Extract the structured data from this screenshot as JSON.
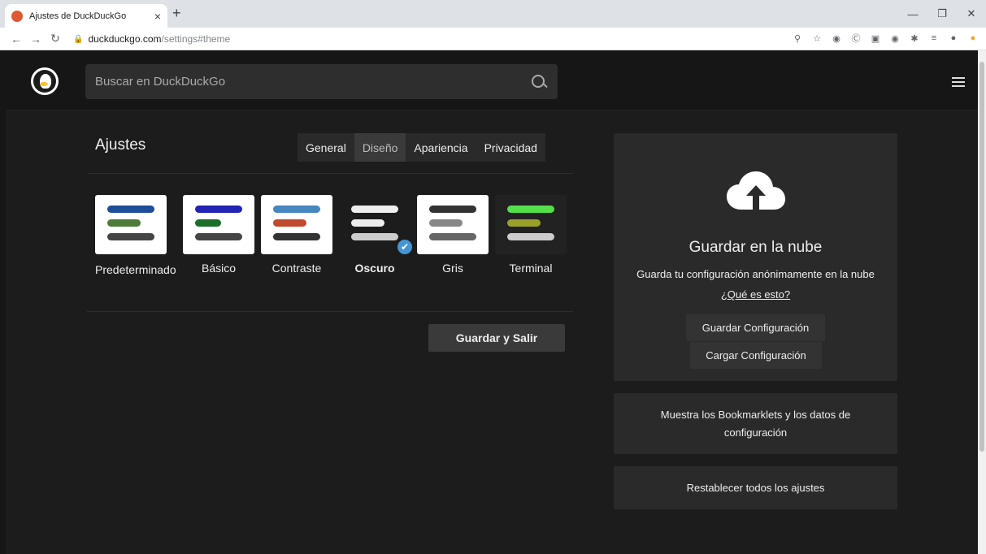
{
  "browser": {
    "tab_title": "Ajustes de DuckDuckGo",
    "url_host": "duckduckgo.com",
    "url_path": "/settings#theme",
    "new_tab": "+",
    "close_tab": "×"
  },
  "search": {
    "placeholder": "Buscar en DuckDuckGo"
  },
  "settings": {
    "title": "Ajustes",
    "tabs": [
      {
        "label": "General"
      },
      {
        "label": "Diseño"
      },
      {
        "label": "Apariencia"
      },
      {
        "label": "Privacidad"
      }
    ],
    "active_tab": "Diseño",
    "themes": [
      {
        "label": "Predeterminado",
        "card_bg": "#ffffff",
        "bars": [
          "#1e4e9a",
          "#4e7a3a",
          "#454545"
        ],
        "selected": false
      },
      {
        "label": "Básico",
        "card_bg": "#ffffff",
        "bars": [
          "#2323b4",
          "#1a6e2a",
          "#454545"
        ],
        "selected": false
      },
      {
        "label": "Contraste",
        "card_bg": "#ffffff",
        "bars": [
          "#4686c1",
          "#c04a2e",
          "#333333"
        ],
        "selected": false
      },
      {
        "label": "Oscuro",
        "card_bg": "#1c1c1c",
        "bars": [
          "#eeeeee",
          "#eeeeee",
          "#cccccc"
        ],
        "selected": true
      },
      {
        "label": "Gris",
        "card_bg": "#ffffff",
        "bars": [
          "#333333",
          "#888888",
          "#666666"
        ],
        "selected": false
      },
      {
        "label": "Terminal",
        "card_bg": "#222222",
        "bars": [
          "#53e04b",
          "#9aa12a",
          "#cccccc"
        ],
        "selected": false
      }
    ],
    "save_exit_label": "Guardar y Salir"
  },
  "cloud": {
    "title": "Guardar en la nube",
    "description": "Guarda tu configuración anónimamente en la nube",
    "link": "¿Qué es esto?",
    "save_label": "Guardar Configuración",
    "load_label": "Cargar Configuración"
  },
  "side": {
    "bookmarklets_label": "Muestra los Bookmarklets y los datos de configuración",
    "reset_label": "Restablecer todos los ajustes"
  }
}
